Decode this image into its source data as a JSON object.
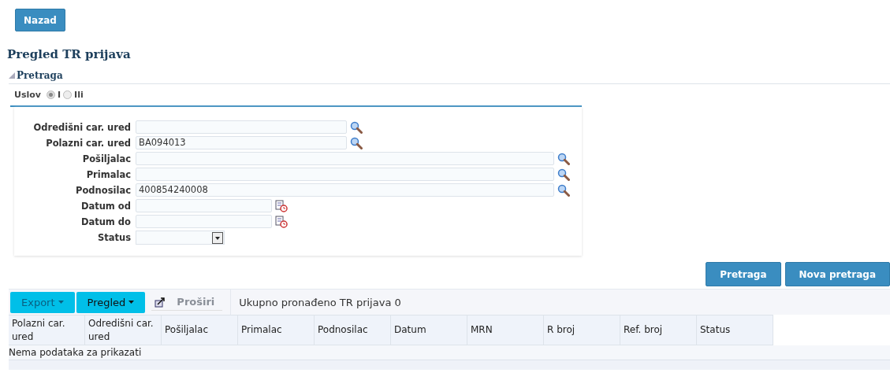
{
  "back_button": "Nazad",
  "page_title": "Pregled TR prijava",
  "search_section": {
    "title": "Pretraga",
    "expanded": true,
    "condition": {
      "label": "Uslov",
      "options": [
        {
          "label": "I",
          "selected": true
        },
        {
          "label": "Ili",
          "selected": false
        }
      ]
    },
    "fields": [
      {
        "label": "Odredišni car. ured",
        "kind": "short"
      },
      {
        "label": "Polazni car. ured",
        "value": "BA094013",
        "kind": "short"
      },
      {
        "label": "Pošiljalac",
        "kind": "long"
      },
      {
        "label": "Primalac",
        "kind": "long"
      },
      {
        "label": "Podnosilac",
        "value": "400854240008",
        "kind": "long"
      },
      {
        "label": "Datum od",
        "kind": "date"
      },
      {
        "label": "Datum do",
        "kind": "date"
      },
      {
        "label": "Status",
        "kind": "select"
      }
    ],
    "buttons": [
      "Pretraga",
      "Nova pretraga"
    ]
  },
  "toolbar": {
    "menus": [
      {
        "label": "Export",
        "disabled": true
      },
      {
        "label": "Pregled",
        "disabled": false
      }
    ],
    "expand_button": {
      "label": "Proširi",
      "disabled": true
    },
    "count": "Ukupno pronađeno TR prijava 0"
  },
  "table": {
    "columns": [
      [
        "Polazni car.",
        "ured"
      ],
      [
        "Odredišni car.",
        "ured"
      ],
      [
        "Pošiljalac"
      ],
      [
        "Primalac"
      ],
      [
        "Podnosilac"
      ],
      [
        "Datum"
      ],
      [
        "MRN"
      ],
      [
        "R broj"
      ],
      [
        "Ref. broj"
      ],
      [
        "Status"
      ]
    ],
    "empty_message": "Nema podataka za prikazati"
  }
}
